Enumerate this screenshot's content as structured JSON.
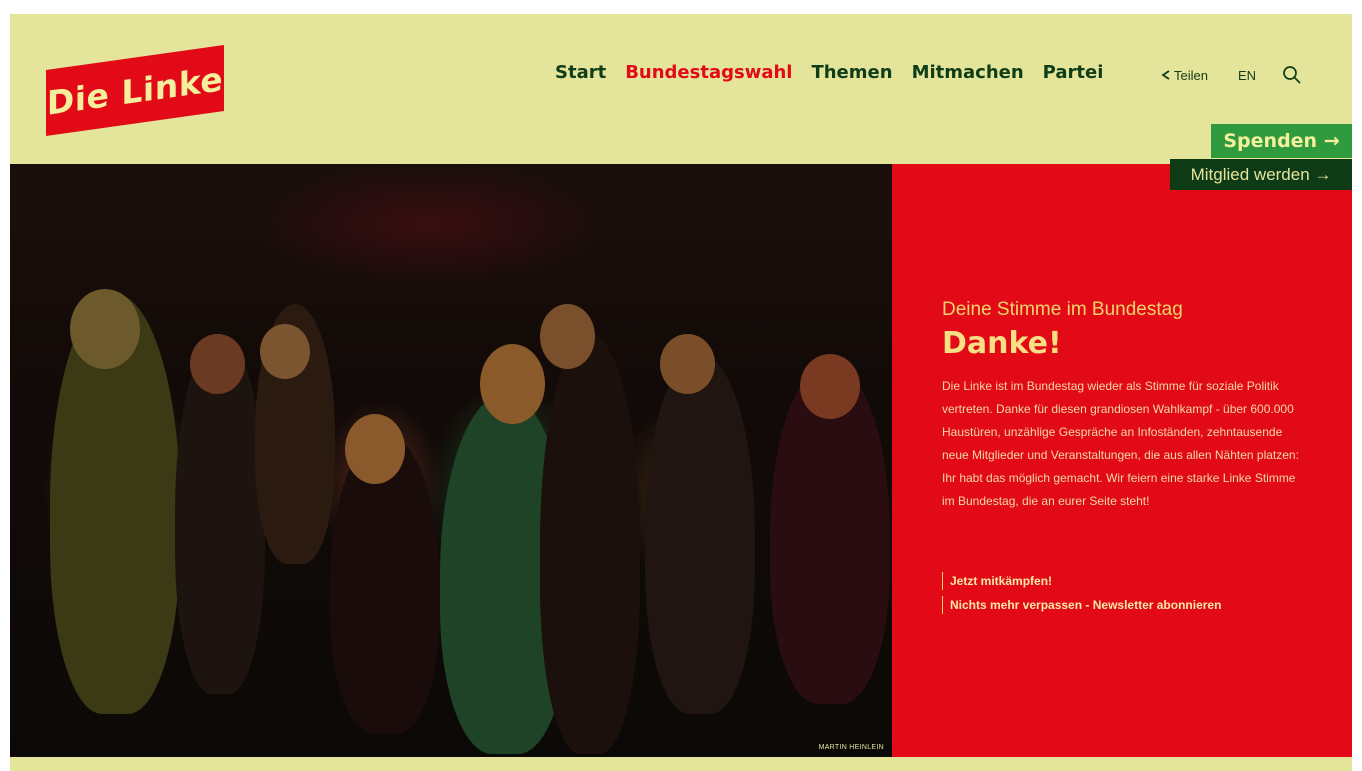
{
  "header": {
    "logo_text": "Die Linke",
    "nav": [
      {
        "label": "Start"
      },
      {
        "label": "Bundestagswahl"
      },
      {
        "label": "Themen"
      },
      {
        "label": "Mitmachen"
      },
      {
        "label": "Partei"
      }
    ],
    "share_label": "Teilen",
    "lang_label": "EN",
    "donate_label": "Spenden →",
    "member_label": "Mitglied werden →"
  },
  "hero": {
    "photo_credit": "MARTIN HEINLEIN",
    "kicker": "Deine Stimme im Bundestag",
    "headline": "Danke!",
    "body": "Die Linke ist im Bundestag wieder als Stimme für soziale Politik vertreten. Danke für diesen grandiosen Wahlkampf - über 600.000 Haustüren, unzählige Gespräche an Infoständen, zehntausende neue Mitglieder und Veranstaltungen, die aus allen Nähten platzen: Ihr habt das möglich gemacht. Wir feiern eine starke Linke Stimme im Bundestag, die an eurer Seite steht!",
    "link_1": "Jetzt mitkämpfen!",
    "link_2": "Nichts mehr verpassen - Newsletter abonnieren"
  },
  "colors": {
    "background": "#e5e49b",
    "brand_red": "#e20a17",
    "nav_green": "#0f3d18",
    "donate_green": "#2f9a3e",
    "member_dark": "#0e3a16"
  },
  "icons": [
    "share-icon",
    "search-icon"
  ]
}
